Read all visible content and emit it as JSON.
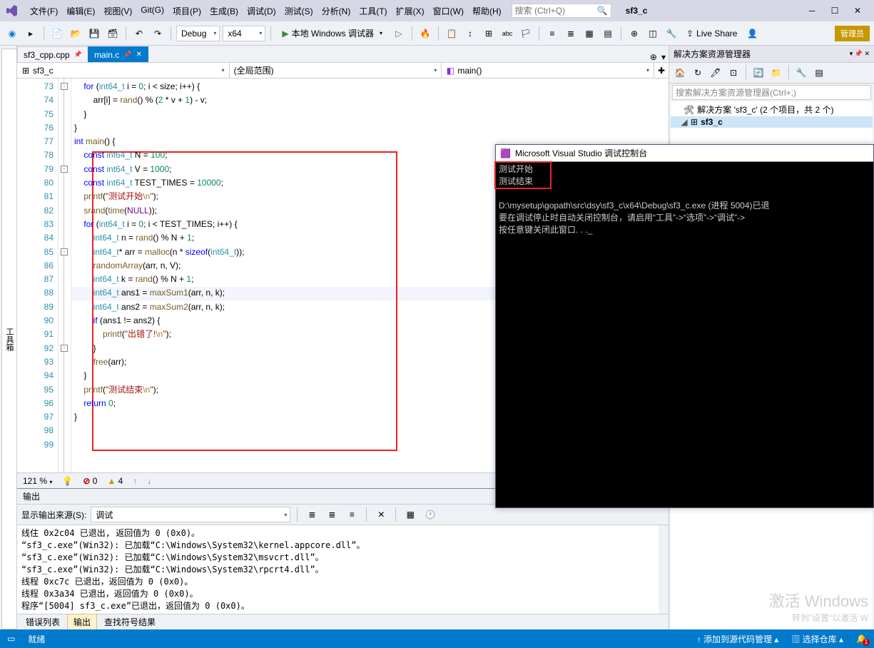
{
  "titlebar": {
    "menus": [
      "文件(F)",
      "编辑(E)",
      "视图(V)",
      "Git(G)",
      "项目(P)",
      "生成(B)",
      "调试(D)",
      "测试(S)",
      "分析(N)",
      "工具(T)",
      "扩展(X)",
      "窗口(W)",
      "帮助(H)"
    ],
    "search_placeholder": "搜索 (Ctrl+Q)",
    "project": "sf3_c",
    "admin": "管理员"
  },
  "toolbar": {
    "config": "Debug",
    "platform": "x64",
    "run_label": "本地 Windows 调试器",
    "live_share": "Live Share"
  },
  "left_tabs": [
    "工具箱"
  ],
  "doc_tabs": [
    {
      "label": "sf3_cpp.cpp",
      "active": false,
      "pinned": true
    },
    {
      "label": "main.c",
      "active": true,
      "pinned": true
    }
  ],
  "nav": {
    "scope1": "sf3_c",
    "scope2": "(全局范围)",
    "scope3": "main()"
  },
  "line_start": 73,
  "code_lines": [
    {
      "html": "    <span class='kw'>for</span> (<span class='ty'>int64_t</span> i = <span class='num'>0</span>; i &lt; size; i++) {"
    },
    {
      "html": "        arr[i] = <span class='fn'>rand</span>() % (<span class='num'>2</span> * v + <span class='num'>1</span>) - v;"
    },
    {
      "html": "    }"
    },
    {
      "html": "}"
    },
    {
      "html": ""
    },
    {
      "html": "<span class='kw'>int</span> <span class='fn'>main</span>() {"
    },
    {
      "html": "    <span class='kw'>const</span> <span class='ty'>int64_t</span> N = <span class='num'>100</span>;"
    },
    {
      "html": "    <span class='kw'>const</span> <span class='ty'>int64_t</span> V = <span class='num'>1000</span>;"
    },
    {
      "html": "    <span class='kw'>const</span> <span class='ty'>int64_t</span> TEST_TIMES = <span class='num'>10000</span>;"
    },
    {
      "html": "    <span class='fn'>printf</span>(<span class='st'>\"测试开始<span class='esc'>\\n</span>\"</span>);"
    },
    {
      "html": "    <span class='fn'>srand</span>(<span class='fn'>time</span>(<span class='mac'>NULL</span>));"
    },
    {
      "html": "    <span class='kw'>for</span> (<span class='ty'>int64_t</span> i = <span class='num'>0</span>; i &lt; TEST_TIMES; i++) {"
    },
    {
      "html": "        <span class='ty'>int64_t</span> n = <span class='fn'>rand</span>() % N + <span class='num'>1</span>;"
    },
    {
      "html": "        <span class='ty'>int64_t</span>* arr = <span class='fn'>malloc</span>(n * <span class='kw'>sizeof</span>(<span class='ty'>int64_t</span>));"
    },
    {
      "html": "        <span class='fn'>randomArray</span>(arr, n, V);"
    },
    {
      "html": "        <span class='ty'>int64_t</span> k = <span class='fn'>rand</span>() % N + <span class='num'>1</span>;"
    },
    {
      "html": "        <span class='ty'>int64_t</span> ans1 = <span class='fn'>maxSum1</span>(arr, n, k);"
    },
    {
      "html": "        <span class='ty'>int64_t</span> ans2 = <span class='fn'>maxSum2</span>(arr, n, k);"
    },
    {
      "html": "        <span class='kw'>if</span> (ans1 != ans2) {"
    },
    {
      "html": "            <span class='fn'>printf</span>(<span class='st'>\"出错了!<span class='esc'>\\n</span>\"</span>);"
    },
    {
      "html": "        }"
    },
    {
      "html": "        <span class='fn'>free</span>(arr);"
    },
    {
      "html": "    }"
    },
    {
      "html": "    <span class='fn'>printf</span>(<span class='st'>\"测试结束<span class='esc'>\\n</span>\"</span>);"
    },
    {
      "html": "    <span class='kw'>return</span> <span class='num'>0</span>;"
    },
    {
      "html": "}"
    },
    {
      "html": ""
    }
  ],
  "highlight_line_index": 15,
  "editor_status": {
    "zoom": "121 %",
    "errors": "0",
    "warnings": "4"
  },
  "output": {
    "title": "输出",
    "from_label": "显示输出来源(S):",
    "from_value": "调试",
    "lines": [
      "线住 0x2c04 已退出, 返回值为 0 (0x0)。",
      "“sf3_c.exe”(Win32): 已加载“C:\\Windows\\System32\\kernel.appcore.dll”。",
      "“sf3_c.exe”(Win32): 已加载“C:\\Windows\\System32\\msvcrt.dll”。",
      "“sf3_c.exe”(Win32): 已加载“C:\\Windows\\System32\\rpcrt4.dll”。",
      "线程 0xc7c 已退出，返回值为 0 (0x0)。",
      "线程 0x3a34 已退出，返回值为 0 (0x0)。",
      "程序“[5004] sf3_c.exe”已退出，返回值为 0 (0x0)。"
    ],
    "tabs": [
      "错误列表",
      "输出",
      "查找符号结果"
    ],
    "active_tab": 1
  },
  "solution": {
    "title": "解决方案资源管理器",
    "search_placeholder": "搜索解决方案资源管理器(Ctrl+;)",
    "root": "解决方案 'sf3_c' (2 个项目，共 2 个)",
    "proj": "sf3_c"
  },
  "console": {
    "title": "Microsoft Visual Studio 调试控制台",
    "line1": "测试开始",
    "line2": "测试结束",
    "body3": "D:\\mysetup\\gopath\\src\\dsy\\sf3_c\\x64\\Debug\\sf3_c.exe (进程 5004)已退",
    "body4": "要在调试停止时自动关闭控制台，请启用“工具”->“选项”->“调试”->",
    "body5": "按任意键关闭此窗口. . ._"
  },
  "statusbar": {
    "ready": "就绪",
    "add_src": "添加到源代码管理",
    "select_repo": "选择仓库"
  },
  "watermark": {
    "big": "激活 Windows",
    "small": "转到\"设置\"以激活 W"
  }
}
